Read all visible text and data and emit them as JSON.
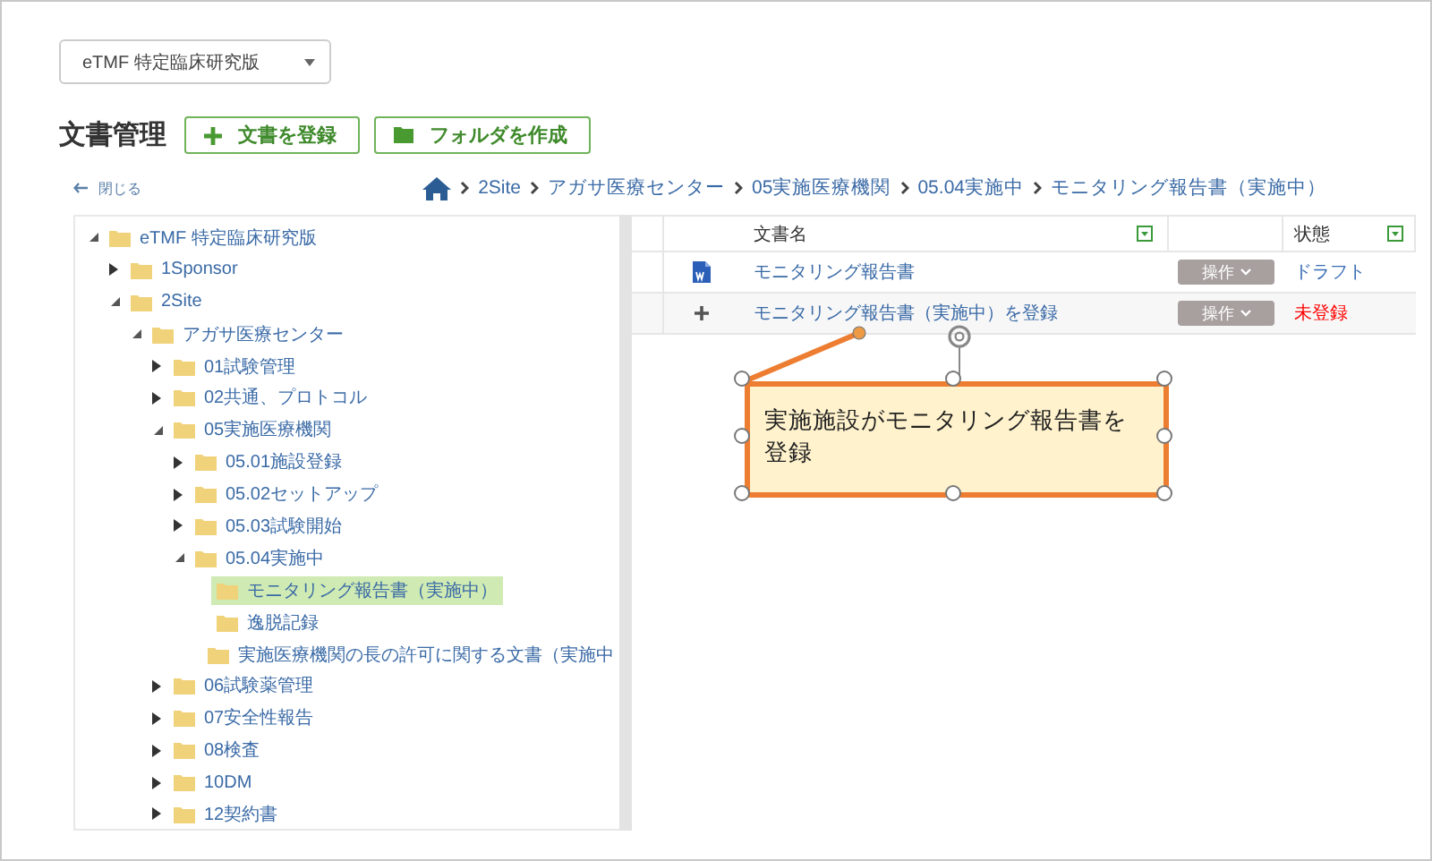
{
  "product_select": {
    "value": "eTMF 特定臨床研究版"
  },
  "page_title": "文書管理",
  "toolbar_buttons": [
    {
      "label": "文書を登録",
      "kind": "plus"
    },
    {
      "label": "フォルダを作成",
      "kind": "folder"
    }
  ],
  "close_link": {
    "label": "閉じる"
  },
  "breadcrumb": [
    "2Site",
    "アガサ医療センター",
    "05実施医療機関",
    "05.04実施中",
    "モニタリング報告書（実施中）"
  ],
  "tree": [
    {
      "label": "eTMF 特定臨床研究版",
      "expanded": true,
      "selected": false,
      "children": [
        {
          "label": "1Sponsor",
          "expanded": false,
          "selected": false
        },
        {
          "label": "2Site",
          "expanded": true,
          "selected": false,
          "children": [
            {
              "label": "アガサ医療センター",
              "expanded": true,
              "selected": false,
              "children": [
                {
                  "label": "01試験管理",
                  "expanded": false,
                  "selected": false
                },
                {
                  "label": "02共通、プロトコル",
                  "expanded": false,
                  "selected": false
                },
                {
                  "label": "05実施医療機関",
                  "expanded": true,
                  "selected": false,
                  "children": [
                    {
                      "label": "05.01施設登録",
                      "expanded": false,
                      "selected": false
                    },
                    {
                      "label": "05.02セットアップ",
                      "expanded": false,
                      "selected": false
                    },
                    {
                      "label": "05.03試験開始",
                      "expanded": false,
                      "selected": false
                    },
                    {
                      "label": "05.04実施中",
                      "expanded": true,
                      "selected": false,
                      "children": [
                        {
                          "label": "モニタリング報告書（実施中）",
                          "selected": true
                        },
                        {
                          "label": "逸脱記録",
                          "selected": false
                        },
                        {
                          "label": "実施医療機関の長の許可に関する文書（実施中",
                          "selected": false
                        }
                      ]
                    }
                  ]
                },
                {
                  "label": "06試験薬管理",
                  "expanded": false,
                  "selected": false
                },
                {
                  "label": "07安全性報告",
                  "expanded": false,
                  "selected": false
                },
                {
                  "label": "08検査",
                  "expanded": false,
                  "selected": false
                },
                {
                  "label": "10DM",
                  "expanded": false,
                  "selected": false
                },
                {
                  "label": "12契約書",
                  "expanded": false,
                  "selected": false
                }
              ]
            }
          ]
        }
      ]
    }
  ],
  "table": {
    "columns": [
      {
        "label": "文書名",
        "filter": true
      },
      {
        "label": "状態",
        "filter": true
      }
    ],
    "rows": [
      {
        "kind": "document",
        "name": "モニタリング報告書",
        "action": "操作",
        "status": "ドラフト",
        "color": "#3b6eb5"
      },
      {
        "kind": "add",
        "name": "モニタリング報告書（実施中）を登録",
        "action": "操作",
        "status": "未登録",
        "color": "#ff0000"
      }
    ]
  },
  "callout": {
    "text": "実施施設がモニタリング報告書を登録",
    "selected": true
  }
}
